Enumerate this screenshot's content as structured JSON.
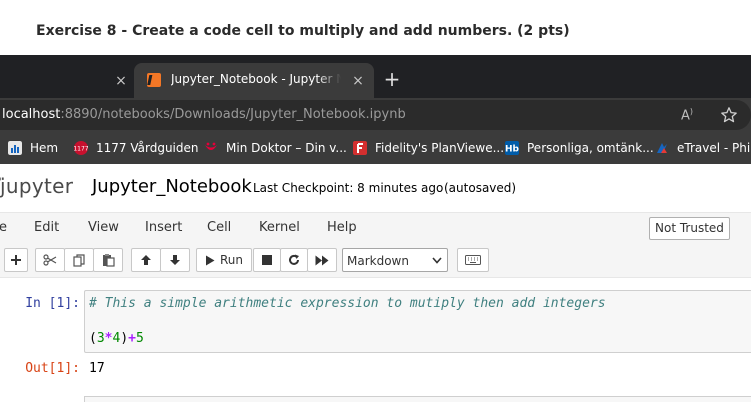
{
  "exercise": {
    "title": "Exercise 8 - Create a code cell to multiply and add numbers. (2 pts)"
  },
  "browser": {
    "active_tab": {
      "title": "Jupyter_Notebook - Jupyter Notebook",
      "icon": "jupyter-favicon"
    },
    "close_glyph": "×",
    "new_tab_glyph": "+",
    "url_host": "localhost",
    "url_rest": ":8890/notebooks/Downloads/Jupyter_Notebook.ipynb",
    "read_aloud": "À",
    "bookmarks": [
      {
        "label": "Hem",
        "icon": "hem-icon",
        "color": "#e8e8e8"
      },
      {
        "label": "1177 Vårdguiden",
        "icon": "vardguiden-icon",
        "color": "#c8102e"
      },
      {
        "label": "Min Doktor – Din v...",
        "icon": "min-doktor-icon",
        "color": "#e4003a"
      },
      {
        "label": "Fidelity's PlanViewe...",
        "icon": "fidelity-icon",
        "color": "#d32f2f"
      },
      {
        "label": "Personliga, omtänk...",
        "icon": "handelsbanken-icon",
        "color": "#005ca9"
      },
      {
        "label": "eTravel - Philip",
        "icon": "etravel-icon",
        "color": "#1565c0"
      }
    ]
  },
  "jupyter": {
    "logo": "jupyter",
    "notebook_name": "Jupyter_Notebook",
    "checkpoint": "Last Checkpoint: 8 minutes ago",
    "autosave": "(autosaved)",
    "menu": [
      "e",
      "Edit",
      "View",
      "Insert",
      "Cell",
      "Kernel",
      "Help"
    ],
    "trust": "Not Trusted",
    "run_label": "Run",
    "cell_type": "Markdown",
    "accent": "#f37726"
  },
  "cells": {
    "in_prompt": "In [1]:",
    "comment": "# This a simple arithmetic expression to mutiply then add integers",
    "code": {
      "paren_open": "(",
      "a": "3",
      "mul": "*",
      "b": "4",
      "paren_close": ")",
      "add": "+",
      "c": "5"
    },
    "out_prompt": "Out[1]:",
    "output": "17"
  }
}
